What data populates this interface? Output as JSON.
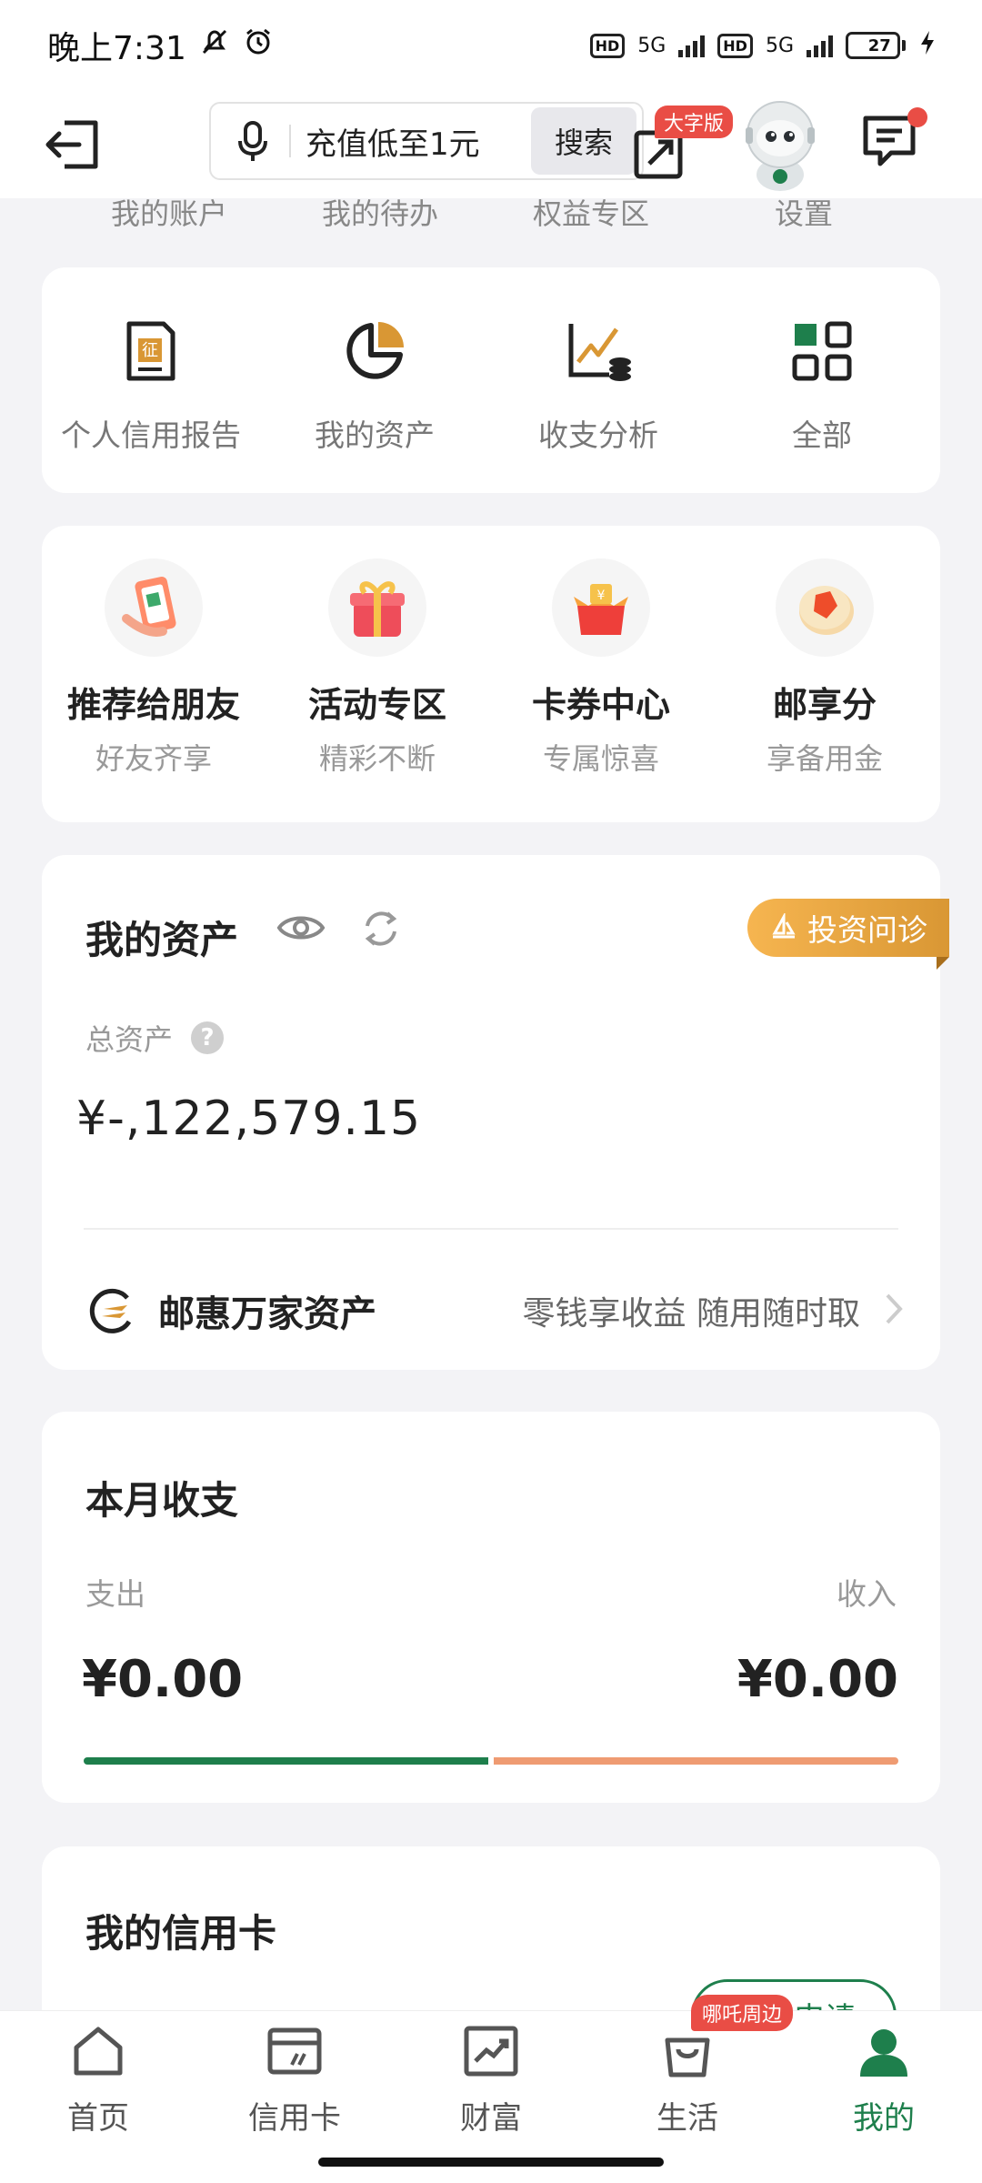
{
  "status_bar": {
    "time": "晚上7:31",
    "network_1": "5G",
    "network_2": "5G",
    "battery": "27",
    "battery_level": 0.27
  },
  "header": {
    "search_placeholder": "充值低至1元",
    "search_button": "搜索",
    "big_font_badge": "大字版"
  },
  "top_tabs": [
    "我的账户",
    "我的待办",
    "权益专区",
    "设置"
  ],
  "quick_actions": [
    {
      "label": "个人信用报告",
      "icon": "credit-report-icon"
    },
    {
      "label": "我的资产",
      "icon": "pie-chart-icon"
    },
    {
      "label": "收支分析",
      "icon": "analysis-icon"
    },
    {
      "label": "全部",
      "icon": "grid-icon"
    }
  ],
  "promotions": [
    {
      "title": "推荐给朋友",
      "subtitle": "好友齐享",
      "icon": "phone-qr-icon"
    },
    {
      "title": "活动专区",
      "subtitle": "精彩不断",
      "icon": "gift-icon"
    },
    {
      "title": "卡券中心",
      "subtitle": "专属惊喜",
      "icon": "coupon-box-icon"
    },
    {
      "title": "邮享分",
      "subtitle": "享备用金",
      "icon": "points-coin-icon"
    }
  ],
  "assets": {
    "title": "我的资产",
    "invest_button": "投资问诊",
    "total_label": "总资产",
    "total_value": "¥-,122,579.15",
    "wanjia_title": "邮惠万家资产",
    "wanjia_desc": "零钱享收益 随用随时取"
  },
  "monthly": {
    "title": "本月收支",
    "expense_label": "支出",
    "income_label": "收入",
    "expense_value": "¥0.00",
    "income_value": "¥0.00",
    "expense_ratio": 0.5
  },
  "credit_card": {
    "title": "我的信用卡",
    "apply_button": "立即申请"
  },
  "tabbar": {
    "tabs": [
      {
        "label": "首页",
        "icon": "home-icon"
      },
      {
        "label": "信用卡",
        "icon": "credit-card-icon"
      },
      {
        "label": "财富",
        "icon": "wealth-chart-icon"
      },
      {
        "label": "生活",
        "icon": "shopping-bag-icon"
      },
      {
        "label": "我的",
        "icon": "profile-icon"
      }
    ],
    "nearby_badge": "哪吒周边",
    "active_index": 4
  },
  "colors": {
    "brand_green": "#1e7f4c",
    "expense_bar": "#1e7f4c",
    "income_bar": "#ef9b72",
    "accent_orange": "#d99734",
    "badge_red": "#e94d45"
  }
}
